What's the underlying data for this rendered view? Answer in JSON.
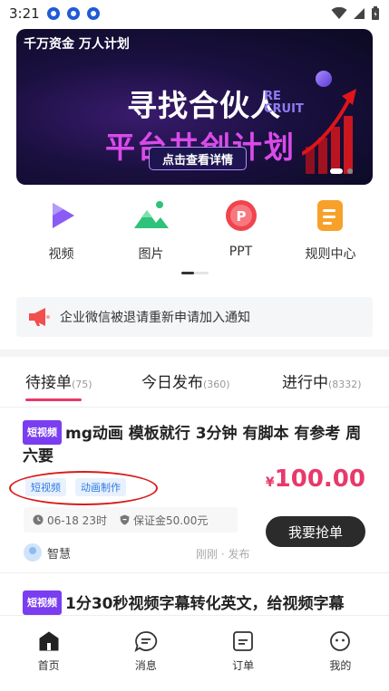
{
  "status_bar": {
    "time": "3:21"
  },
  "banner": {
    "tag": "千万资金 万人计划",
    "headline": "寻找合伙人",
    "recruit": "RE\nCRUIT",
    "headline2": "平台共创计划",
    "cta": "点击查看详情"
  },
  "categories": [
    {
      "label": "视频",
      "icon": "play-icon",
      "color": "#8a5cf6"
    },
    {
      "label": "图片",
      "icon": "image-icon",
      "color": "#2fc27a"
    },
    {
      "label": "PPT",
      "icon": "ppt-icon",
      "color": "#f0444e"
    },
    {
      "label": "规则中心",
      "icon": "document-icon",
      "color": "#f7a12b"
    }
  ],
  "notice": {
    "text": "企业微信被退请重新申请加入通知",
    "icon": "megaphone-icon"
  },
  "tabs": [
    {
      "label": "待接单",
      "count": "(75)",
      "active": true
    },
    {
      "label": "今日发布",
      "count": "(360)",
      "active": false
    },
    {
      "label": "进行中",
      "count": "(8332)",
      "active": false
    }
  ],
  "cards": [
    {
      "badge": "短视频",
      "title": "mg动画 模板就行 3分钟 有脚本 有参考 周六要",
      "tags": [
        "短视频",
        "动画制作"
      ],
      "currency": "¥",
      "price": "100.00",
      "deadline": "06-18 23时",
      "deposit": "保证金50.00元",
      "button": "我要抢单",
      "user": "智慧",
      "posted": "刚刚 · 发布"
    },
    {
      "badge": "短视频",
      "title": "1分30秒视频字幕转化英文，给视频字幕"
    }
  ],
  "bottom_nav": [
    {
      "label": "首页",
      "icon": "home-icon",
      "active": true
    },
    {
      "label": "消息",
      "icon": "message-icon",
      "active": false
    },
    {
      "label": "订单",
      "icon": "order-icon",
      "active": false
    },
    {
      "label": "我的",
      "icon": "profile-icon",
      "active": false
    }
  ],
  "colors": {
    "accent": "#e8396a",
    "badge": "#7a3ef0",
    "chip_text": "#2f7be5"
  }
}
